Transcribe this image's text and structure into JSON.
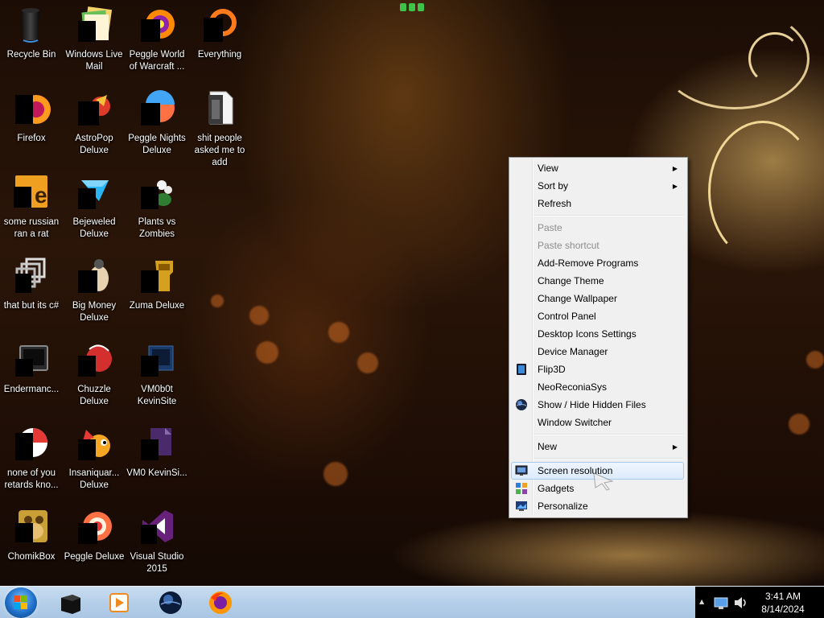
{
  "desktop_icons": [
    {
      "label": "Recycle Bin",
      "icon": "recycle-bin-icon"
    },
    {
      "label": "Windows Live Mail",
      "icon": "windows-live-mail-icon"
    },
    {
      "label": "Peggle World of Warcraft ...",
      "icon": "peggle-wow-icon"
    },
    {
      "label": "Everything",
      "icon": "everything-icon"
    },
    {
      "label": "Firefox",
      "icon": "firefox-icon"
    },
    {
      "label": "AstroPop Deluxe",
      "icon": "astropop-icon"
    },
    {
      "label": "Peggle Nights Deluxe",
      "icon": "peggle-nights-icon"
    },
    {
      "label": "shit people asked me to add",
      "icon": "folder-icon"
    },
    {
      "label": "some russian ran a rat",
      "icon": "some-russian-icon"
    },
    {
      "label": "Bejeweled Deluxe",
      "icon": "bejeweled-icon"
    },
    {
      "label": "Plants vs Zombies",
      "icon": "plants-vs-zombies-icon"
    },
    {
      "label": "that but its c#",
      "icon": "shortcut-stack-icon"
    },
    {
      "label": "Big Money Deluxe",
      "icon": "big-money-icon"
    },
    {
      "label": "Zuma Deluxe",
      "icon": "zuma-icon"
    },
    {
      "label": "Endermanc...",
      "icon": "endermanch-icon"
    },
    {
      "label": "Chuzzle Deluxe",
      "icon": "chuzzle-icon"
    },
    {
      "label": "VM0b0t KevinSite",
      "icon": "vm0b0t-icon"
    },
    {
      "label": "none of you retards kno...",
      "icon": "none-of-you-icon"
    },
    {
      "label": "Insaniquar... Deluxe",
      "icon": "insaniquarium-icon"
    },
    {
      "label": "VM0 KevinSi...",
      "icon": "vm0-icon"
    },
    {
      "label": "ChomikBox",
      "icon": "chomikbox-icon"
    },
    {
      "label": "Peggle Deluxe",
      "icon": "peggle-deluxe-icon"
    },
    {
      "label": "Visual Studio 2015",
      "icon": "visual-studio-icon"
    }
  ],
  "context_menu": {
    "items": [
      {
        "label": "View",
        "submenu": true,
        "enabled": true
      },
      {
        "label": "Sort by",
        "submenu": true,
        "enabled": true
      },
      {
        "label": "Refresh",
        "enabled": true
      },
      {
        "label": "Paste",
        "enabled": false
      },
      {
        "label": "Paste shortcut",
        "enabled": false
      },
      {
        "label": "Add-Remove Programs",
        "enabled": true
      },
      {
        "label": "Change Theme",
        "enabled": true
      },
      {
        "label": "Change Wallpaper",
        "enabled": true
      },
      {
        "label": "Control Panel",
        "enabled": true
      },
      {
        "label": "Desktop Icons Settings",
        "enabled": true
      },
      {
        "label": "Device Manager",
        "enabled": true
      },
      {
        "label": "Flip3D",
        "enabled": true,
        "icon": "flip3d-icon"
      },
      {
        "label": "NeoReconiaSys",
        "enabled": true
      },
      {
        "label": "Show / Hide Hidden Files",
        "enabled": true,
        "icon": "globe-icon"
      },
      {
        "label": "Window Switcher",
        "enabled": true
      },
      {
        "label": "New",
        "submenu": true,
        "enabled": true
      },
      {
        "label": "Screen resolution",
        "enabled": true,
        "icon": "monitor-icon",
        "highlighted": true
      },
      {
        "label": "Gadgets",
        "enabled": true,
        "icon": "gadgets-icon"
      },
      {
        "label": "Personalize",
        "enabled": true,
        "icon": "personalize-icon"
      }
    ]
  },
  "taskbar": {
    "pinned": [
      {
        "name": "taskbar-black-box",
        "icon": "black-box-icon"
      },
      {
        "name": "taskbar-media-player",
        "icon": "media-player-icon"
      },
      {
        "name": "taskbar-globe",
        "icon": "globe-icon"
      },
      {
        "name": "taskbar-firefox",
        "icon": "firefox-icon"
      }
    ]
  },
  "tray": {
    "time": "3:41 AM",
    "date": "8/14/2024"
  },
  "colors": {
    "menu_bg": "#f0f0f0",
    "menu_highlight": "#dcebfc",
    "taskbar": "#b5cfe9",
    "wallpaper_accent": "#f3b04a"
  }
}
